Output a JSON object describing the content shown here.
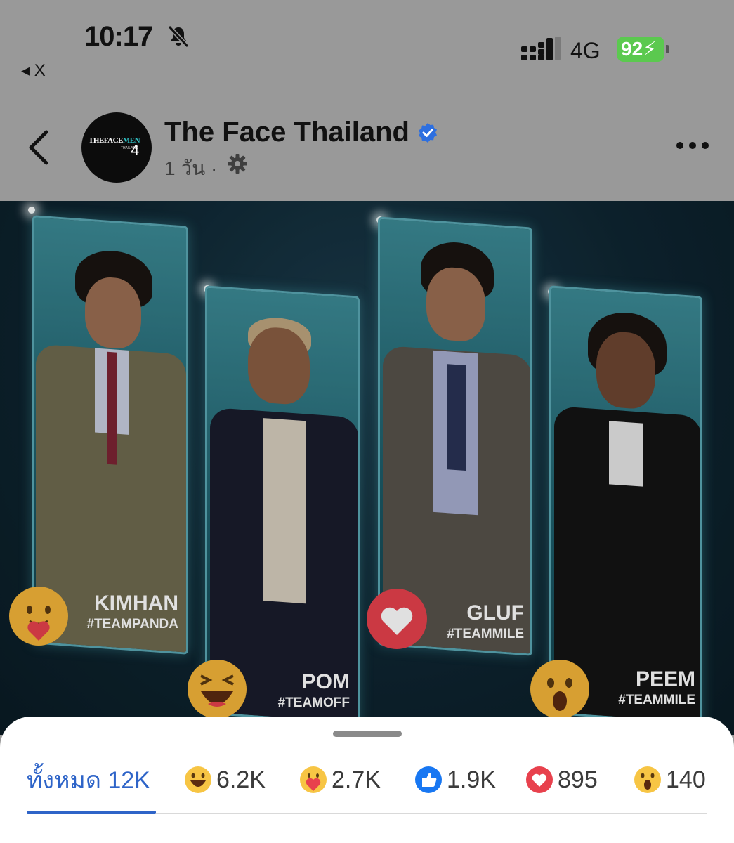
{
  "status_bar": {
    "time": "10:17",
    "back_app": "◂ X",
    "network": "4G",
    "battery": "92"
  },
  "header": {
    "page_name": "The Face Thailand",
    "meta": "1 วัน ·",
    "avatar": {
      "logo_top": "THEFACE",
      "logo_men": "MEN",
      "logo_sub": "THAILAND",
      "logo_num": "4"
    }
  },
  "post_image": {
    "cards": [
      {
        "name": "KIMHAN",
        "team": "#TEAMPANDA"
      },
      {
        "name": "POM",
        "team": "#TEAMOFF"
      },
      {
        "name": "GLUF",
        "team": "#TEAMMILE"
      },
      {
        "name": "PEEM",
        "team": "#TEAMMILE"
      }
    ]
  },
  "reactions": {
    "tabs": [
      {
        "label": "ทั้งหมด 12K",
        "icon": "all-tab"
      },
      {
        "label": "6.2K",
        "icon": "haha-icon"
      },
      {
        "label": "2.7K",
        "icon": "care-icon"
      },
      {
        "label": "1.9K",
        "icon": "like-icon"
      },
      {
        "label": "895",
        "icon": "love-icon"
      },
      {
        "label": "140",
        "icon": "wow-icon"
      }
    ]
  },
  "colors": {
    "accent": "#2e64c8",
    "love": "#e8414d",
    "like": "#1877f2",
    "emoji_yellow": "#f7c544",
    "battery": "#5bc94f"
  }
}
